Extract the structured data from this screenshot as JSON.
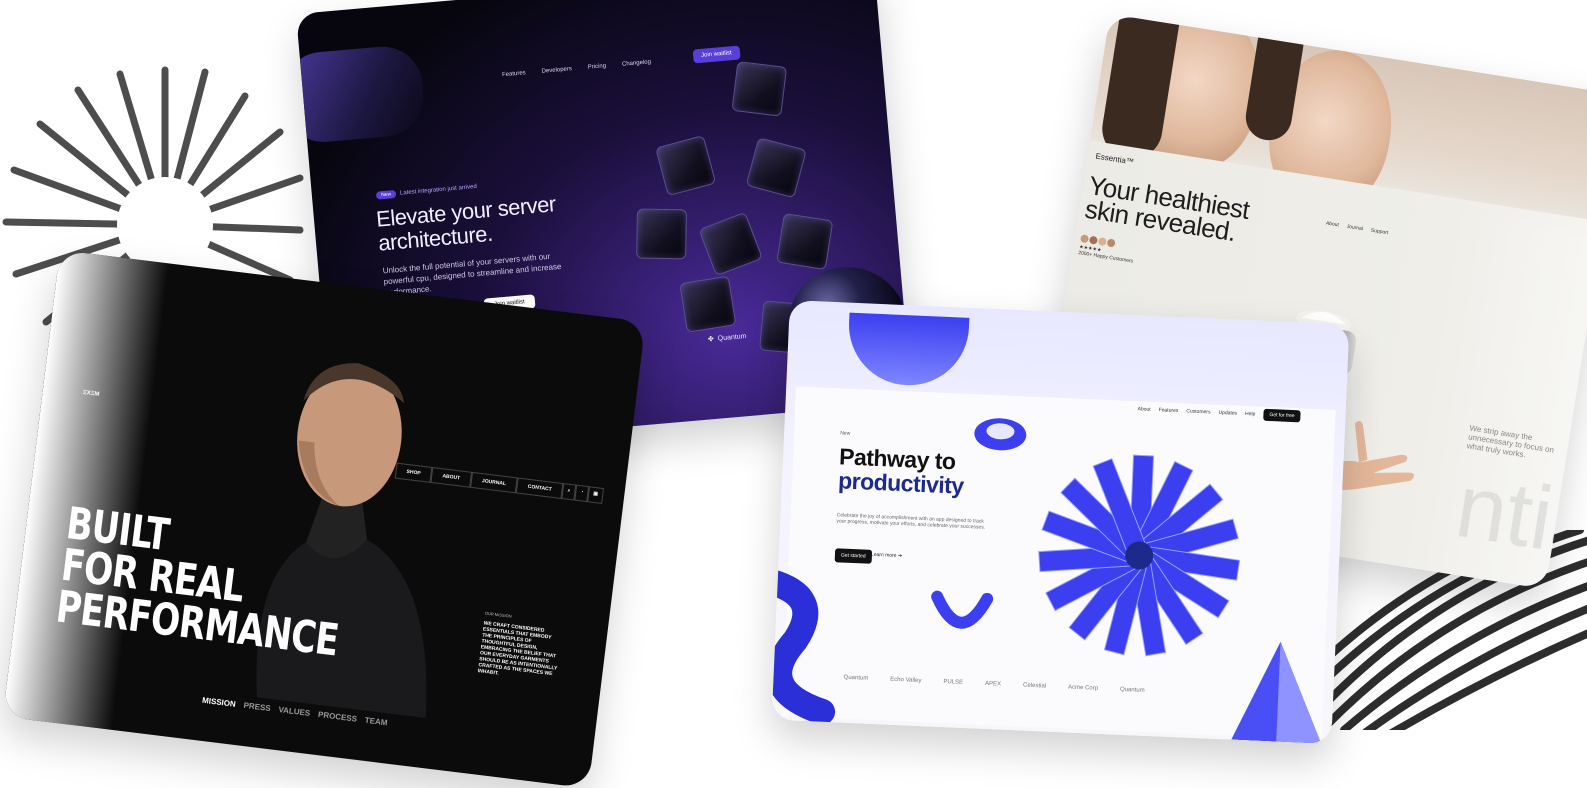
{
  "quantum": {
    "nav": [
      "Features",
      "Developers",
      "Pricing",
      "Changelog"
    ],
    "join_top": "Join waitlist",
    "badge_pill": "New",
    "badge_text": "Latest integration just arrived",
    "title": "Elevate your server architecture.",
    "body": "Unlock the full potential of your servers with our powerful cpu, designed to streamline and increase performance.",
    "join_cta": "Join waitlist",
    "logo": "Quantum",
    "colors": {
      "accent": "#5a3ed8",
      "bg": "#0b0816"
    }
  },
  "built": {
    "logo": "ΞXΞM",
    "nav": [
      "SHOP",
      "ABOUT",
      "JOURNAL",
      "CONTACT"
    ],
    "title_lines": [
      "BUILT",
      "FOR REAL",
      "PERFORMANCE"
    ],
    "mission_label": "OUR MISSION",
    "mission_text": "WE CRAFT CONSIDERED ESSENTIALS THAT EMBODY THE PRINCIPLES OF THOUGHTFUL DESIGN, EMBRACING THE BELIEF THAT OUR EVERYDAY GARMENTS SHOULD BE AS INTENTIONALLY CRAFTED AS THE SPACES WE INHABIT.",
    "bottom_nav": [
      "MISSION",
      "PRESS",
      "VALUES",
      "PROCESS",
      "TEAM"
    ]
  },
  "essentia": {
    "logo": "Essentia™",
    "nav": [
      "About",
      "Journal",
      "Support"
    ],
    "title": "Your healthiest skin revealed.",
    "rating_stars": "★★★★★",
    "rating_text": "2000+ Happy Customers",
    "side_text": "We strip away the unnecessary to focus on what truly works.",
    "watermark": "ntia"
  },
  "pathway": {
    "new_label": "New",
    "nav": [
      "About",
      "Features",
      "Customers",
      "Updates",
      "Help"
    ],
    "nav_cta": "Get for free",
    "title_line1": "Pathway to",
    "title_line2": "productivity",
    "body": "Celebrate the joy of accomplishment with an app designed to track your progress, motivate your efforts, and celebrate your successes.",
    "cta": "Get started",
    "link": "Learn more ➔",
    "logos": [
      "Quantum",
      "Echo Valley",
      "PULSE",
      "APEX",
      "Celestial",
      "Acme Corp",
      "Quantum"
    ],
    "colors": {
      "accent": "#1d2a8c",
      "shape": "#3b3ff0"
    }
  }
}
